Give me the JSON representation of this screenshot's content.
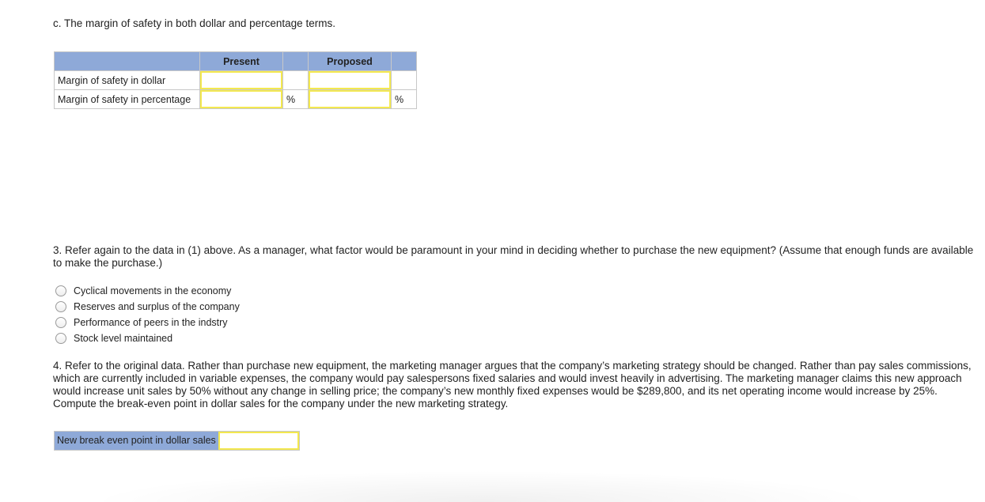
{
  "part_c": {
    "heading": "c. The margin of safety in both dollar and percentage terms.",
    "table": {
      "headers": [
        "",
        "Present",
        "",
        "Proposed",
        ""
      ],
      "rows": [
        {
          "label": "Margin of safety in dollar",
          "present_value": "",
          "present_unit": "",
          "proposed_value": "",
          "proposed_unit": ""
        },
        {
          "label": "Margin of safety in percentage",
          "present_value": "",
          "present_unit": "%",
          "proposed_value": "",
          "proposed_unit": "%"
        }
      ]
    }
  },
  "question3": {
    "text": "3. Refer again to the data in (1) above. As a manager, what factor would be paramount in your mind in deciding whether to purchase the new equipment? (Assume that enough funds are available to make the purchase.)",
    "options": [
      {
        "label": "Cyclical movements in the economy",
        "selected": false
      },
      {
        "label": "Reserves and surplus of the company",
        "selected": false
      },
      {
        "label": "Performance of peers in the indstry",
        "selected": false
      },
      {
        "label": "Stock level maintained",
        "selected": false
      }
    ]
  },
  "question4": {
    "text": "4. Refer to the original data. Rather than purchase new equipment, the marketing manager argues that the company’s marketing strategy should be changed. Rather than pay sales commissions, which are currently included in variable expenses, the company would pay salespersons fixed salaries and would invest heavily in advertising. The marketing manager claims this new approach would increase unit sales by 50% without any change in selling price; the company’s new monthly fixed expenses would be $289,800, and its net operating income would increase by 25%. Compute the break-even point in dollar sales for the company under the new marketing strategy.",
    "answer_label": "New break even point in dollar sales",
    "answer_value": ""
  },
  "colors": {
    "header_bg": "#8ea9d8",
    "input_border": "#f3e84f",
    "cell_border": "#c8c8c8"
  }
}
